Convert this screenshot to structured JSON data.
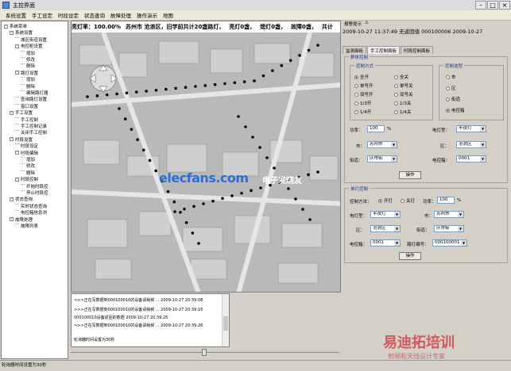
{
  "window": {
    "title": "主控界面",
    "min_icon": "minimize-icon",
    "max_icon": "maximize-icon",
    "close_icon": "close-icon"
  },
  "menu": [
    "系统设置",
    "手工设定",
    "时段设定",
    "状态查询",
    "故障处理",
    "操作演示",
    "地图"
  ],
  "tree": [
    {
      "label": "系统菜单",
      "level": 0,
      "exp": "-"
    },
    {
      "label": "系统设置",
      "level": 1,
      "exp": "-"
    },
    {
      "label": "城区街道设置",
      "level": 2,
      "exp": ""
    },
    {
      "label": "电控柜设置",
      "level": 2,
      "exp": "-"
    },
    {
      "label": "增加",
      "level": 3,
      "exp": ""
    },
    {
      "label": "修改",
      "level": 3,
      "exp": ""
    },
    {
      "label": "删除",
      "level": 3,
      "exp": ""
    },
    {
      "label": "路灯设置",
      "level": 2,
      "exp": "-"
    },
    {
      "label": "增加",
      "level": 3,
      "exp": ""
    },
    {
      "label": "删除",
      "level": 3,
      "exp": ""
    },
    {
      "label": "编辑路灯器",
      "level": 3,
      "exp": ""
    },
    {
      "label": "查询路灯设置",
      "level": 2,
      "exp": ""
    },
    {
      "label": "窗口设置",
      "level": 2,
      "exp": ""
    },
    {
      "label": "手工设置",
      "level": 1,
      "exp": "-"
    },
    {
      "label": "手工控制",
      "level": 2,
      "exp": ""
    },
    {
      "label": "手工控制记录",
      "level": 2,
      "exp": ""
    },
    {
      "label": "关闭手工控制",
      "level": 2,
      "exp": ""
    },
    {
      "label": "时段设置",
      "level": 1,
      "exp": "-"
    },
    {
      "label": "时段设定",
      "level": 2,
      "exp": ""
    },
    {
      "label": "时段编辑",
      "level": 2,
      "exp": "-"
    },
    {
      "label": "增加",
      "level": 3,
      "exp": ""
    },
    {
      "label": "修改",
      "level": 3,
      "exp": ""
    },
    {
      "label": "删除",
      "level": 3,
      "exp": ""
    },
    {
      "label": "时段控制",
      "level": 2,
      "exp": "-"
    },
    {
      "label": "开始时段控",
      "level": 3,
      "exp": ""
    },
    {
      "label": "停止时段控",
      "level": 3,
      "exp": ""
    },
    {
      "label": "状态查询",
      "level": 1,
      "exp": "-"
    },
    {
      "label": "实时状态查询",
      "level": 2,
      "exp": ""
    },
    {
      "label": "电控箱信息浏",
      "level": 2,
      "exp": ""
    },
    {
      "label": "故障处理",
      "level": 1,
      "exp": "-"
    },
    {
      "label": "故障列表",
      "level": 2,
      "exp": ""
    }
  ],
  "map_status": {
    "rate": "亮灯率：100.00%",
    "area": "苏州市 沧浪区，旧学前共计20盏路灯，",
    "lit": "亮灯0盏，",
    "off": "熄灯0盏，",
    "fault": "故障0盏，",
    "total": "共计"
  },
  "log": [
    ">>>正在写数据到000100010的设备请稍候 ... 2009-10-27 20:39:08",
    ">>>正在写数据到000100010的设备请稍候 ... 2009-10-27 20:39:16",
    "000100010设备返回的数据 2009-10-27 20:39:25",
    ">>>正在写数据到000100010的设备请稍候 ... 2009-10-27 20:39:26",
    "轮询器时间设置为30秒"
  ],
  "right": {
    "alarm_label": "报警提示",
    "clock": "2009-10-27 11:37:49 无返回值 000100006 2009-10-27",
    "tabs": [
      "监测面板",
      "手工控制面板",
      "时段控制面板"
    ],
    "batch": {
      "title": "群体控制",
      "mode_title": "控制方式",
      "modes": [
        "全开",
        "全关",
        "单号开",
        "单号关",
        "双号开",
        "双号关",
        "1/3开",
        "1/3关",
        "1/4开",
        "1/4关"
      ],
      "type_title": "控制选型",
      "types": [
        "市",
        "区",
        "街道",
        "电控箱"
      ],
      "power_label": "功率：",
      "power_value": "100",
      "power_unit": "%",
      "lamp_type_label": "电灯型：",
      "lamp_type_value": "半夜灯",
      "city_label": "市：",
      "city_value": "苏州市",
      "district_label": "区：",
      "district_value": "沧浪区",
      "street_label": "街道：",
      "street_value": "庆市街",
      "box_label": "电控箱：",
      "box_value": "0001",
      "exec": "操作"
    },
    "single": {
      "title": "单灯控制",
      "ctl_label": "控制方法：",
      "on": "开灯",
      "off": "关灯",
      "power_label": "功率：",
      "power_value": "100",
      "power_unit": "%",
      "lamp_type_label": "电灯型：",
      "lamp_type_value": "半夜灯",
      "city_label": "市：",
      "city_value": "苏州市",
      "district_label": "区：",
      "district_value": "沧浪区",
      "street_label": "街道：",
      "street_value": "庆市街",
      "box_label": "电控箱：",
      "box_value": "0001",
      "lamp_no_label": "路灯编号：",
      "lamp_no_value": "000100001",
      "exec": "操作"
    }
  },
  "statusbar": "轮询器时间设置为30秒",
  "watermarks": {
    "site": "elecfans.com",
    "site_cn": "电子发烧友",
    "brand": "易迪拓培训",
    "slogan": "射频和天线设计专家"
  }
}
